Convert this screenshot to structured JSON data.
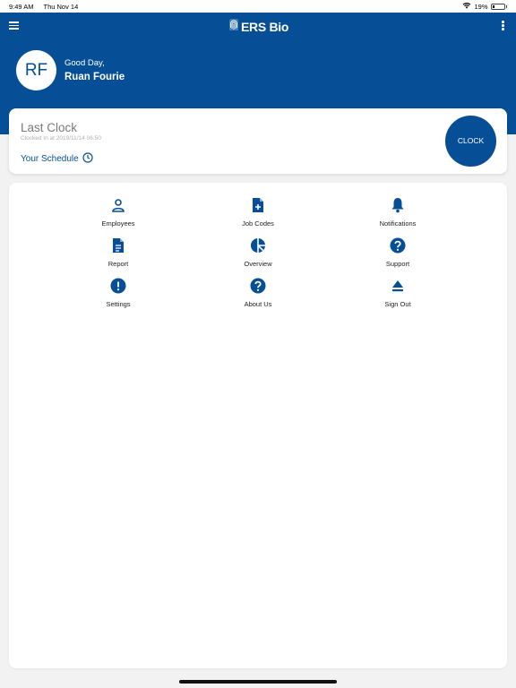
{
  "status_bar": {
    "time": "9:49 AM",
    "date": "Thu Nov 14",
    "battery": "19%",
    "battery_level": 0.19
  },
  "app": {
    "title": "ERS Bio"
  },
  "user": {
    "initials": "RF",
    "greeting": "Good Day,",
    "name": "Ruan Fourie"
  },
  "clock_card": {
    "title": "Last Clock",
    "subtitle": "Clocked In at 2019/11/14 06:50",
    "schedule_label": "Your Schedule",
    "clock_button": "CLOCK"
  },
  "menu": [
    {
      "label": "Employees",
      "icon": "person-icon"
    },
    {
      "label": "Job Codes",
      "icon": "document-plus-icon"
    },
    {
      "label": "Notifications",
      "icon": "bell-icon"
    },
    {
      "label": "Report",
      "icon": "document-icon"
    },
    {
      "label": "Overview",
      "icon": "pie-chart-icon"
    },
    {
      "label": "Support",
      "icon": "help-circle-icon"
    },
    {
      "label": "Settings",
      "icon": "alert-circle-icon"
    },
    {
      "label": "About Us",
      "icon": "question-circle-icon"
    },
    {
      "label": "Sign Out",
      "icon": "eject-icon"
    }
  ],
  "colors": {
    "brand": "#064f96",
    "background": "#f2f2f2"
  }
}
